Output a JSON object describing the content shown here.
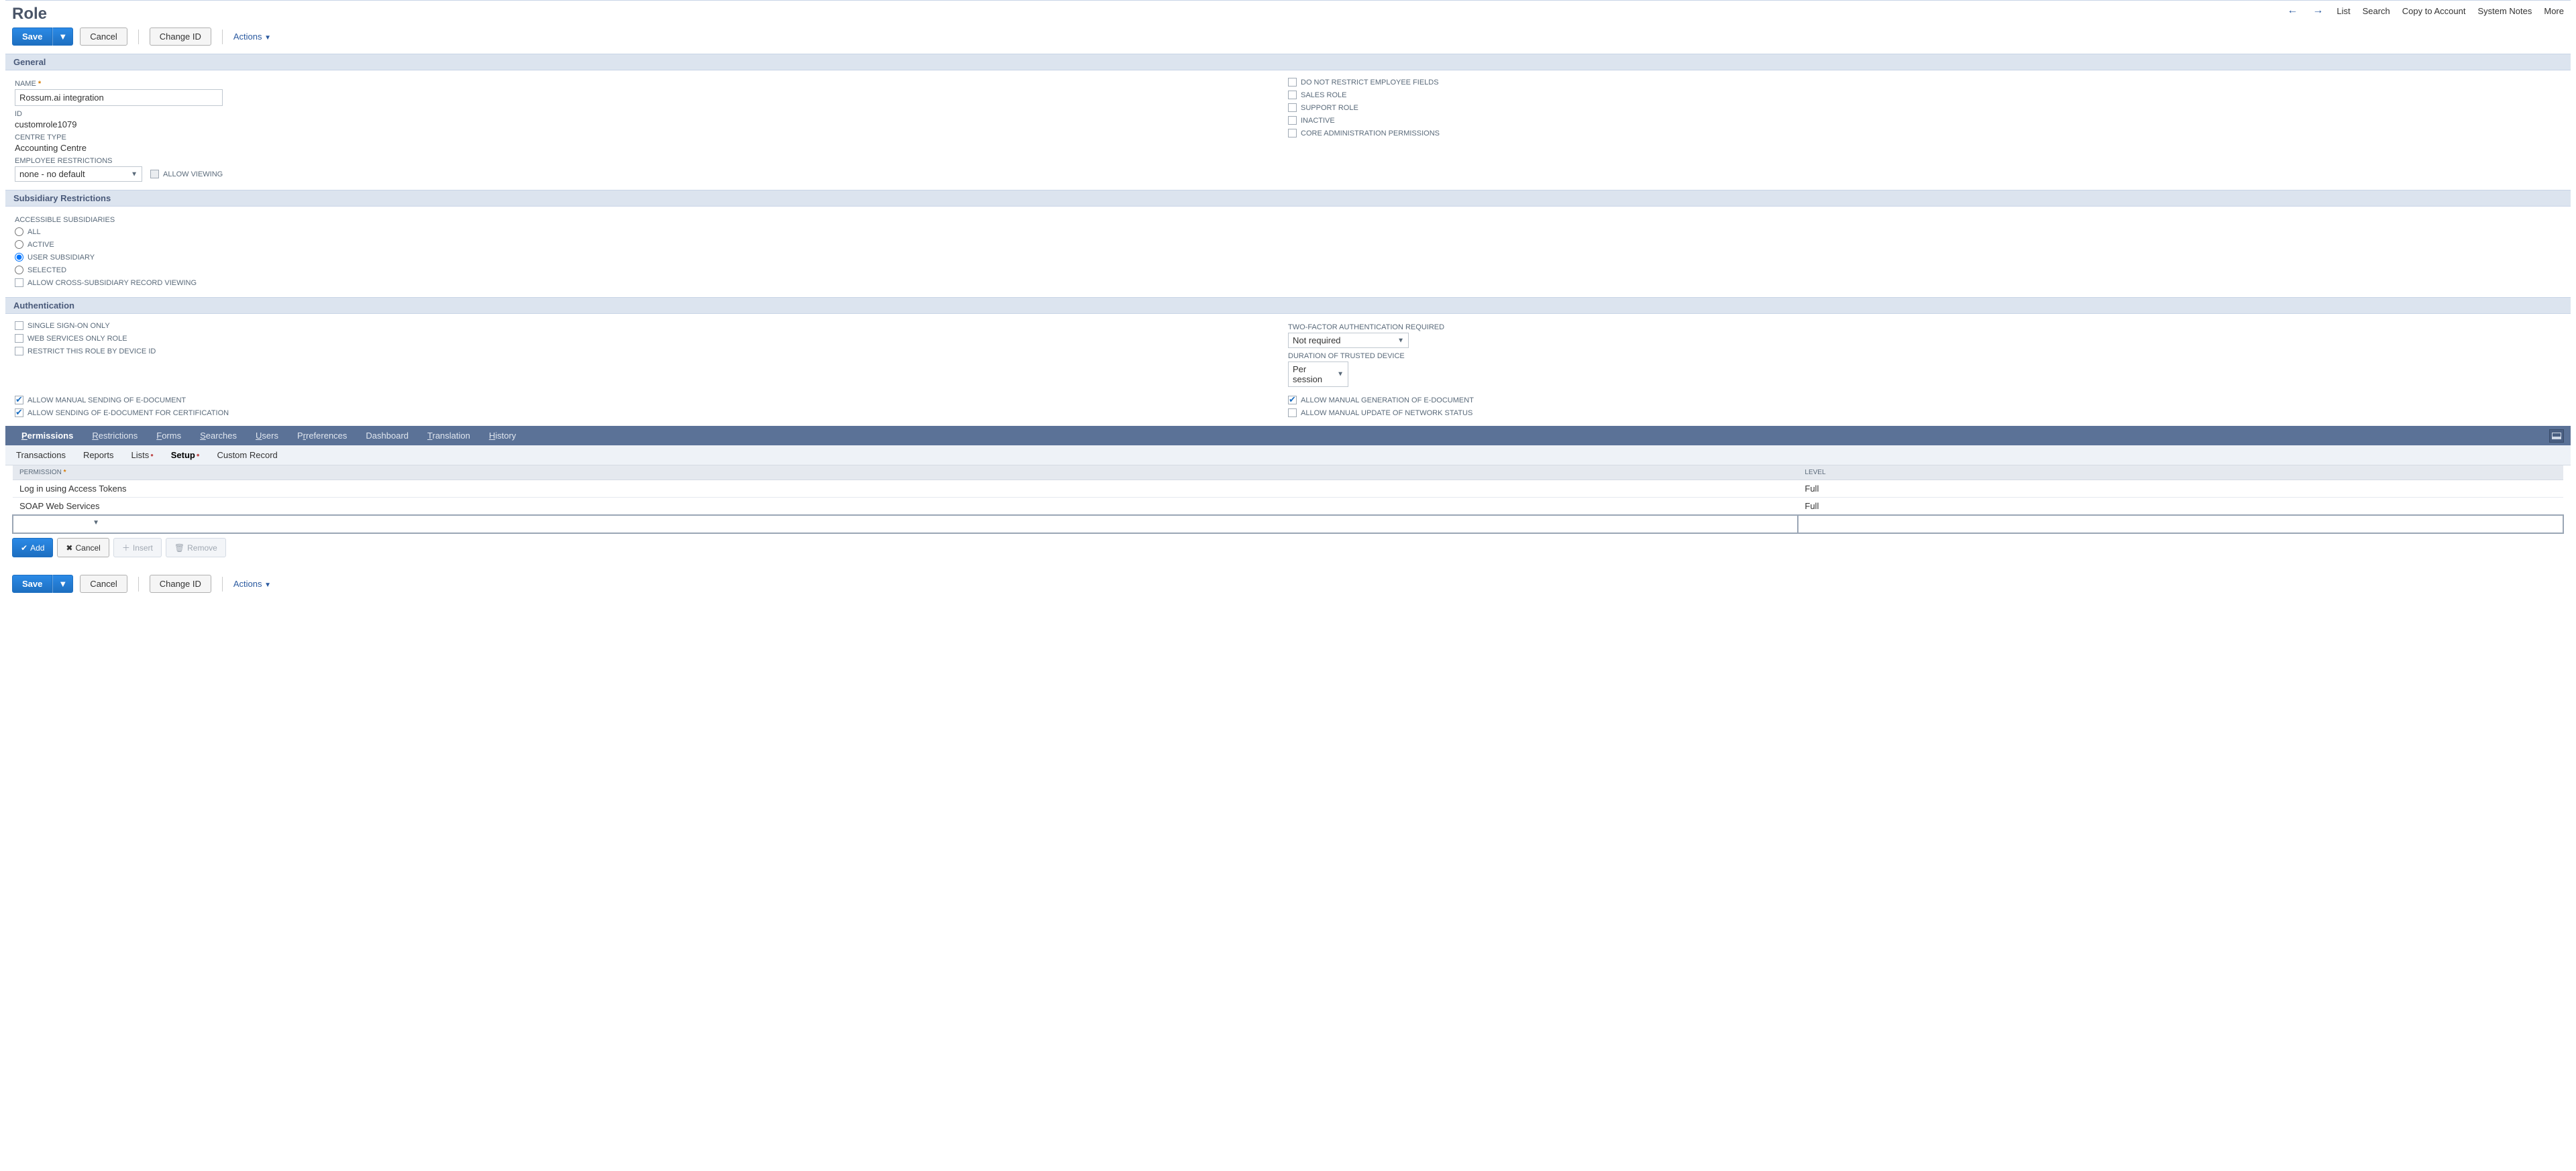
{
  "page_title": "Role",
  "top_nav": {
    "list": "List",
    "search": "Search",
    "copy": "Copy to Account",
    "notes": "System Notes",
    "more": "More"
  },
  "toolbar": {
    "save": "Save",
    "cancel": "Cancel",
    "change_id": "Change ID",
    "actions": "Actions"
  },
  "sections": {
    "general": "General",
    "subsidiary": "Subsidiary Restrictions",
    "auth": "Authentication"
  },
  "general": {
    "name_label": "NAME",
    "name_value": "Rossum.ai integration",
    "id_label": "ID",
    "id_value": "customrole1079",
    "centre_type_label": "CENTRE TYPE",
    "centre_type_value": "Accounting Centre",
    "emp_restrict_label": "EMPLOYEE RESTRICTIONS",
    "emp_restrict_value": "none - no default",
    "allow_viewing": "ALLOW VIEWING",
    "right_checks": {
      "no_restrict_emp": "DO NOT RESTRICT EMPLOYEE FIELDS",
      "sales_role": "SALES ROLE",
      "support_role": "SUPPORT ROLE",
      "inactive": "INACTIVE",
      "core_admin": "CORE ADMINISTRATION PERMISSIONS"
    }
  },
  "subsidiary": {
    "accessible_label": "ACCESSIBLE SUBSIDIARIES",
    "all": "ALL",
    "active": "ACTIVE",
    "user_sub": "USER SUBSIDIARY",
    "selected": "SELECTED",
    "allow_cross": "ALLOW CROSS-SUBSIDIARY RECORD VIEWING"
  },
  "auth": {
    "sso": "SINGLE SIGN-ON ONLY",
    "ws_only": "WEB SERVICES ONLY ROLE",
    "restrict_device": "RESTRICT THIS ROLE BY DEVICE ID",
    "tfa_label": "TWO-FACTOR AUTHENTICATION REQUIRED",
    "tfa_value": "Not required",
    "duration_label": "DURATION OF TRUSTED DEVICE",
    "duration_value": "Per session",
    "allow_send_edoc": "ALLOW MANUAL SENDING OF E-DOCUMENT",
    "allow_send_cert": "ALLOW SENDING OF E-DOCUMENT FOR CERTIFICATION",
    "allow_gen_edoc": "ALLOW MANUAL GENERATION OF E-DOCUMENT",
    "allow_update_net": "ALLOW MANUAL UPDATE OF NETWORK STATUS"
  },
  "tabs": {
    "permissions": "ermissions",
    "restrictions": "estrictions",
    "forms": "orms",
    "searches": "earches",
    "users": "sers",
    "preferences": "references",
    "dashboard": "Dashboard",
    "translation": "ranslation",
    "history": "istory"
  },
  "subtabs": {
    "transactions": "Transactions",
    "reports": "Reports",
    "lists": "Lists",
    "setup": "Setup",
    "custom": "Custom Record"
  },
  "perm_table": {
    "col_permission": "PERMISSION",
    "col_level": "LEVEL",
    "rows": [
      {
        "permission": "Log in using Access Tokens",
        "level": "Full"
      },
      {
        "permission": "SOAP Web Services",
        "level": "Full"
      }
    ]
  },
  "row_actions": {
    "add": "Add",
    "cancel": "Cancel",
    "insert": "Insert",
    "remove": "Remove"
  }
}
